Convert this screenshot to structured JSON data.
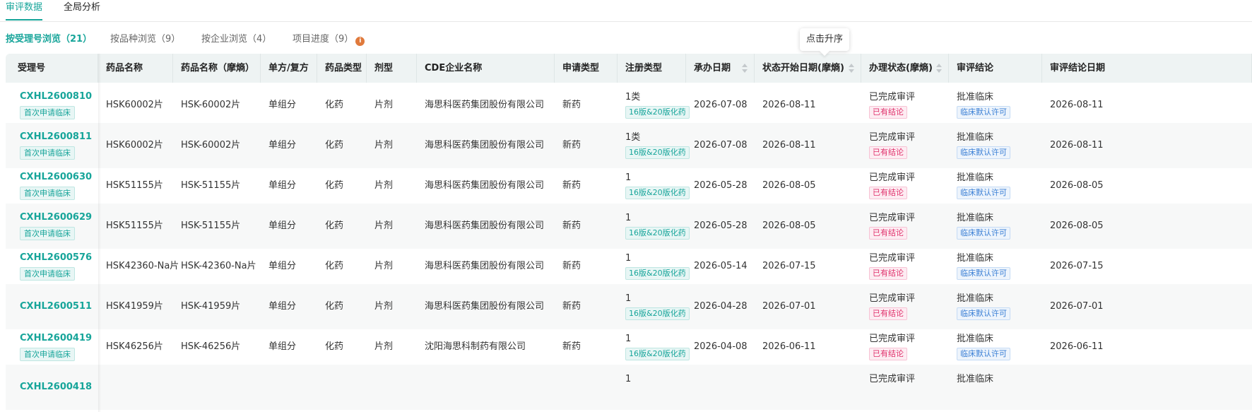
{
  "top_tabs": [
    "审评数据",
    "全局分析"
  ],
  "sub_tabs": [
    "按受理号浏览（21）",
    "按品种浏览（9）",
    "按企业浏览（4）",
    "项目进度（9）"
  ],
  "info_icon": "i",
  "tooltip": "点击升序",
  "columns": [
    "受理号",
    "药品名称",
    "药品名称（摩熵）",
    "单方/复方",
    "药品类型",
    "剂型",
    "CDE企业名称",
    "申请类型",
    "注册类型",
    "承办日期",
    "状态开始日期(摩熵)",
    "办理状态(摩熵)",
    "审评结论",
    "审评结论日期"
  ],
  "rows": [
    {
      "id": "CXHL2600810",
      "id_tag": "首次申请临床",
      "drug": "HSK60002片",
      "drug_ms": "HSK-60002片",
      "single": "单组分",
      "dtype": "化药",
      "form": "片剂",
      "company": "海思科医药集团股份有限公司",
      "apply": "新药",
      "reg": "1类",
      "reg_tag": "16版&20版化药",
      "undertake": "2026-07-08",
      "status_start": "2026-08-11",
      "status": "已完成审评",
      "status_tag": "已有结论",
      "conclusion": "批准临床",
      "conclusion_tag": "临床默认许可",
      "conclusion_date": "2026-08-11"
    },
    {
      "id": "CXHL2600811",
      "id_tag": "首次申请临床",
      "drug": "HSK60002片",
      "drug_ms": "HSK-60002片",
      "single": "单组分",
      "dtype": "化药",
      "form": "片剂",
      "company": "海思科医药集团股份有限公司",
      "apply": "新药",
      "reg": "1类",
      "reg_tag": "16版&20版化药",
      "undertake": "2026-07-08",
      "status_start": "2026-08-11",
      "status": "已完成审评",
      "status_tag": "已有结论",
      "conclusion": "批准临床",
      "conclusion_tag": "临床默认许可",
      "conclusion_date": "2026-08-11"
    },
    {
      "id": "CXHL2600630",
      "id_tag": "首次申请临床",
      "drug": "HSK51155片",
      "drug_ms": "HSK-51155片",
      "single": "单组分",
      "dtype": "化药",
      "form": "片剂",
      "company": "海思科医药集团股份有限公司",
      "apply": "新药",
      "reg": "1",
      "reg_tag": "16版&20版化药",
      "undertake": "2026-05-28",
      "status_start": "2026-08-05",
      "status": "已完成审评",
      "status_tag": "已有结论",
      "conclusion": "批准临床",
      "conclusion_tag": "临床默认许可",
      "conclusion_date": "2026-08-05"
    },
    {
      "id": "CXHL2600629",
      "id_tag": "首次申请临床",
      "drug": "HSK51155片",
      "drug_ms": "HSK-51155片",
      "single": "单组分",
      "dtype": "化药",
      "form": "片剂",
      "company": "海思科医药集团股份有限公司",
      "apply": "新药",
      "reg": "1",
      "reg_tag": "16版&20版化药",
      "undertake": "2026-05-28",
      "status_start": "2026-08-05",
      "status": "已完成审评",
      "status_tag": "已有结论",
      "conclusion": "批准临床",
      "conclusion_tag": "临床默认许可",
      "conclusion_date": "2026-08-05"
    },
    {
      "id": "CXHL2600576",
      "id_tag": "首次申请临床",
      "drug": "HSK42360-Na片",
      "drug_ms": "HSK-42360-Na片",
      "single": "单组分",
      "dtype": "化药",
      "form": "片剂",
      "company": "海思科医药集团股份有限公司",
      "apply": "新药",
      "reg": "1",
      "reg_tag": "16版&20版化药",
      "undertake": "2026-05-14",
      "status_start": "2026-07-15",
      "status": "已完成审评",
      "status_tag": "已有结论",
      "conclusion": "批准临床",
      "conclusion_tag": "临床默认许可",
      "conclusion_date": "2026-07-15"
    },
    {
      "id": "CXHL2600511",
      "id_tag": "",
      "drug": "HSK41959片",
      "drug_ms": "HSK-41959片",
      "single": "单组分",
      "dtype": "化药",
      "form": "片剂",
      "company": "海思科医药集团股份有限公司",
      "apply": "新药",
      "reg": "1",
      "reg_tag": "16版&20版化药",
      "undertake": "2026-04-28",
      "status_start": "2026-07-01",
      "status": "已完成审评",
      "status_tag": "已有结论",
      "conclusion": "批准临床",
      "conclusion_tag": "临床默认许可",
      "conclusion_date": "2026-07-01"
    },
    {
      "id": "CXHL2600419",
      "id_tag": "首次申请临床",
      "drug": "HSK46256片",
      "drug_ms": "HSK-46256片",
      "single": "单组分",
      "dtype": "化药",
      "form": "片剂",
      "company": "沈阳海思科制药有限公司",
      "apply": "新药",
      "reg": "1",
      "reg_tag": "16版&20版化药",
      "undertake": "2026-04-08",
      "status_start": "2026-06-11",
      "status": "已完成审评",
      "status_tag": "已有结论",
      "conclusion": "批准临床",
      "conclusion_tag": "临床默认许可",
      "conclusion_date": "2026-06-11"
    },
    {
      "id": "CXHL2600418",
      "id_tag": "",
      "drug": "",
      "drug_ms": "",
      "single": "",
      "dtype": "",
      "form": "",
      "company": "",
      "apply": "",
      "reg": "1",
      "reg_tag": "",
      "undertake": "",
      "status_start": "",
      "status": "已完成审评",
      "status_tag": "",
      "conclusion": "批准临床",
      "conclusion_tag": "",
      "conclusion_date": ""
    }
  ],
  "colors": {
    "accent": "#17a59a",
    "header_bg": "#eef3f3",
    "status_tag": "#e0316c",
    "conclusion_tag": "#3a7fd5",
    "info_icon": "#e07a3c"
  }
}
